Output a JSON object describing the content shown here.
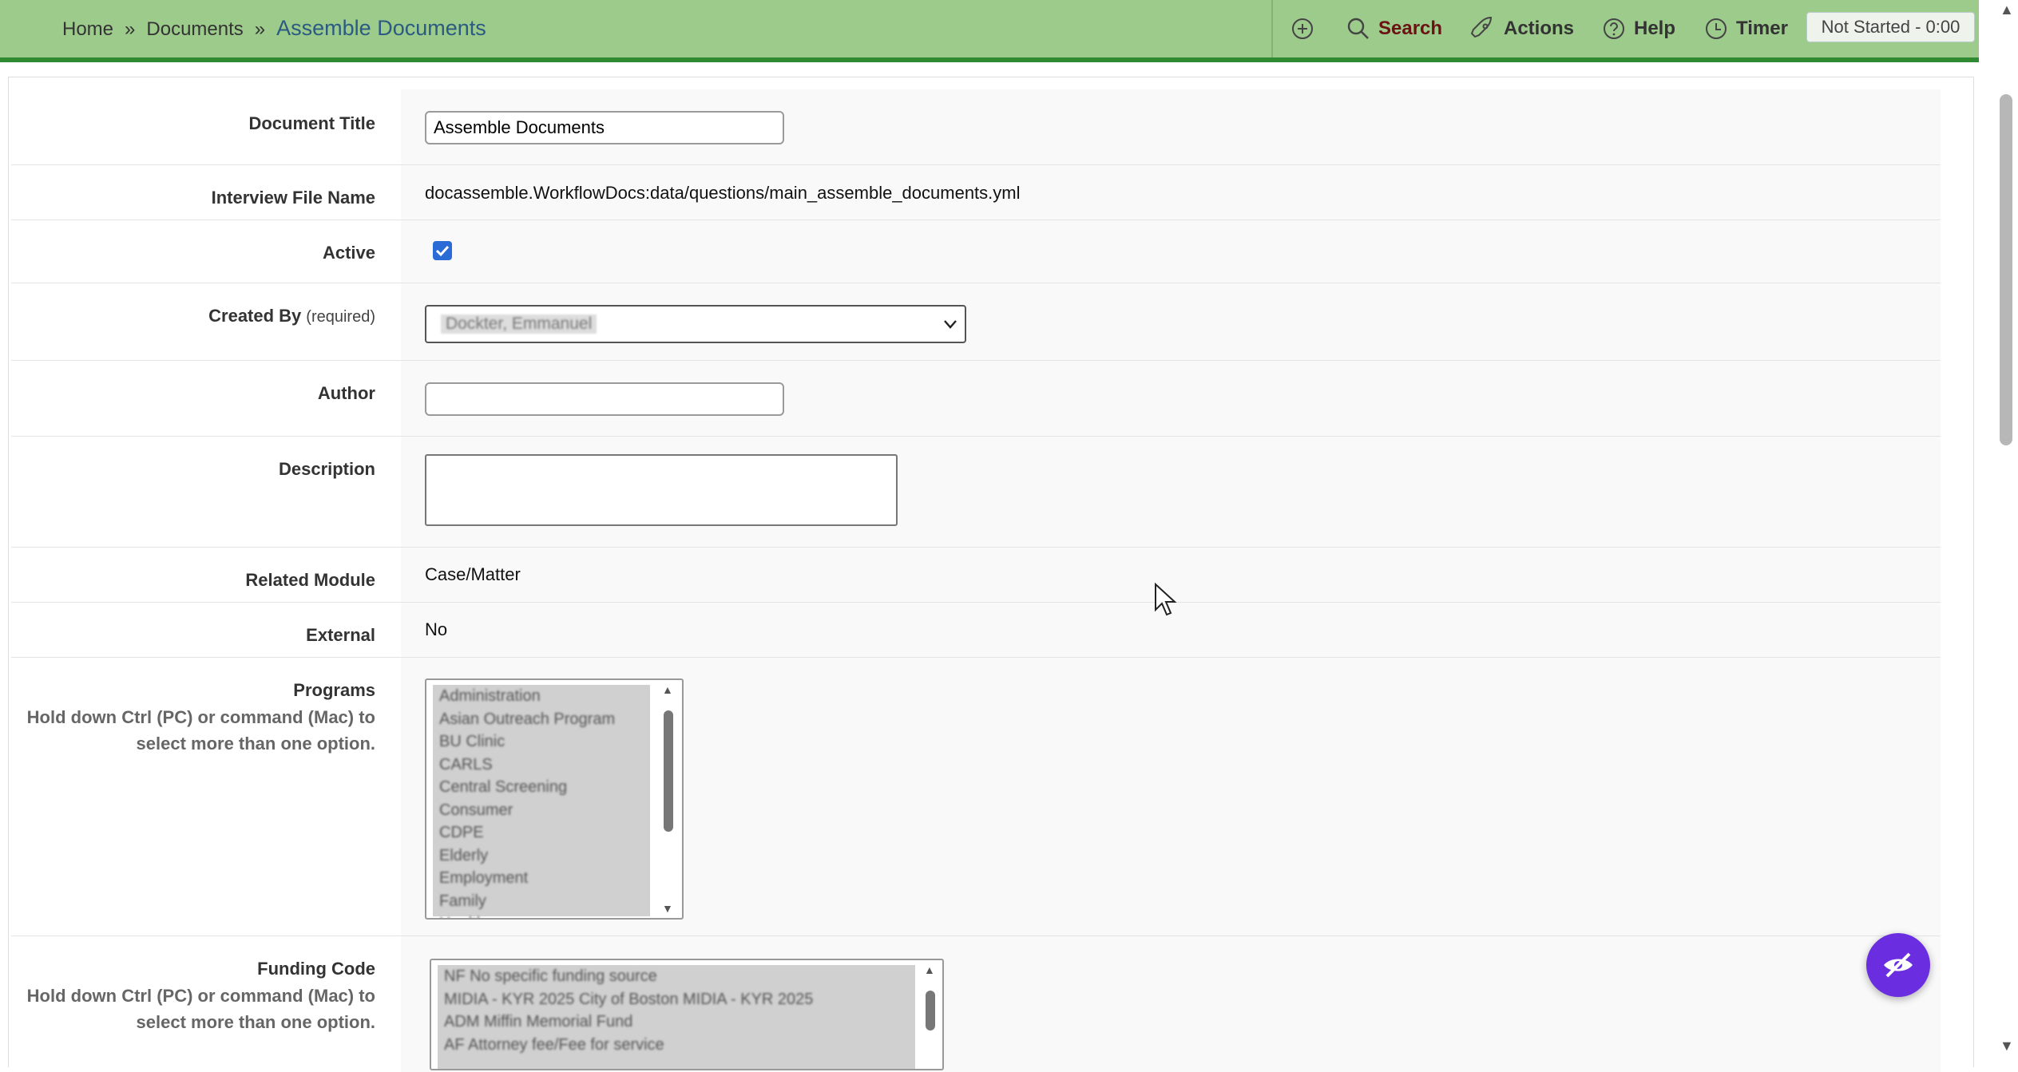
{
  "breadcrumb": {
    "home": "Home",
    "separator": "»",
    "documents": "Documents",
    "current": "Assemble Documents"
  },
  "toolbar": {
    "add_icon": "plus-circle-icon",
    "search_label": "Search",
    "actions_label": "Actions",
    "help_label": "Help",
    "timer_label": "Timer",
    "timer_status": "Not Started - 0:00"
  },
  "form": {
    "document_title": {
      "label": "Document Title",
      "value": "Assemble Documents"
    },
    "interview_file_name": {
      "label": "Interview File Name",
      "value": "docassemble.WorkflowDocs:data/questions/main_assemble_documents.yml"
    },
    "active": {
      "label": "Active",
      "checked": true
    },
    "created_by": {
      "label": "Created By",
      "required": "(required)",
      "value": "Dockter, Emmanuel"
    },
    "author": {
      "label": "Author",
      "value": ""
    },
    "description": {
      "label": "Description",
      "value": ""
    },
    "related_module": {
      "label": "Related Module",
      "value": "Case/Matter"
    },
    "external": {
      "label": "External",
      "value": "No"
    },
    "programs": {
      "label": "Programs",
      "hint": "Hold down Ctrl (PC) or command (Mac) to select more than one option.",
      "options": [
        "Administration",
        "Asian Outreach Program",
        "BU Clinic",
        "CARLS",
        "Central Screening",
        "Consumer",
        "CDPE",
        "Elderly",
        "Employment",
        "Family",
        "Health"
      ]
    },
    "funding_code": {
      "label": "Funding Code",
      "hint": "Hold down Ctrl (PC) or command (Mac) to select more than one option.",
      "options": [
        "NF No specific funding source",
        "MIDIA - KYR 2025 City of Boston MIDIA - KYR 2025",
        "ADM Miffin Memorial Fund",
        "AF Attorney fee/Fee for service"
      ]
    }
  },
  "colors": {
    "topbar_bg": "#9ccb8b",
    "topbar_border": "#2f8a32",
    "breadcrumb_current": "#2b5a82",
    "search_text": "#6b1313",
    "checkbox": "#2a6bd6",
    "fab": "#6a2ee0"
  },
  "fab_icon": "no-eye-icon"
}
